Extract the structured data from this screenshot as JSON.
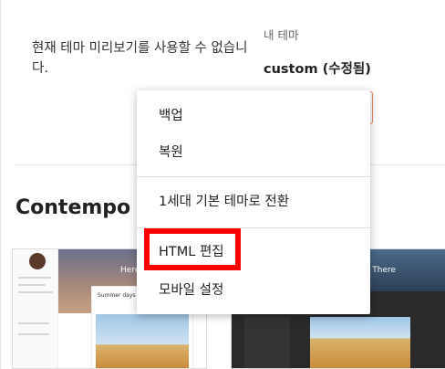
{
  "preview": {
    "message": "현재 테마 미리보기를 사용할 수 없습니다."
  },
  "my_theme": {
    "label": "내 테마",
    "name": "custom (수정됨)"
  },
  "section": {
    "title": "Contempo"
  },
  "thumbnails": {
    "left_hero_text": "Here a",
    "left_card_title": "Summer days in Santorini",
    "right_hero_text": "nd There"
  },
  "menu": {
    "items": [
      {
        "label": "백업"
      },
      {
        "label": "복원"
      },
      {
        "label": "1세대 기본 테마로 전환"
      },
      {
        "label": "HTML 편집"
      },
      {
        "label": "모바일 설정"
      }
    ]
  },
  "colors": {
    "highlight": "#ff0000",
    "accent_border": "#f28b6b"
  }
}
